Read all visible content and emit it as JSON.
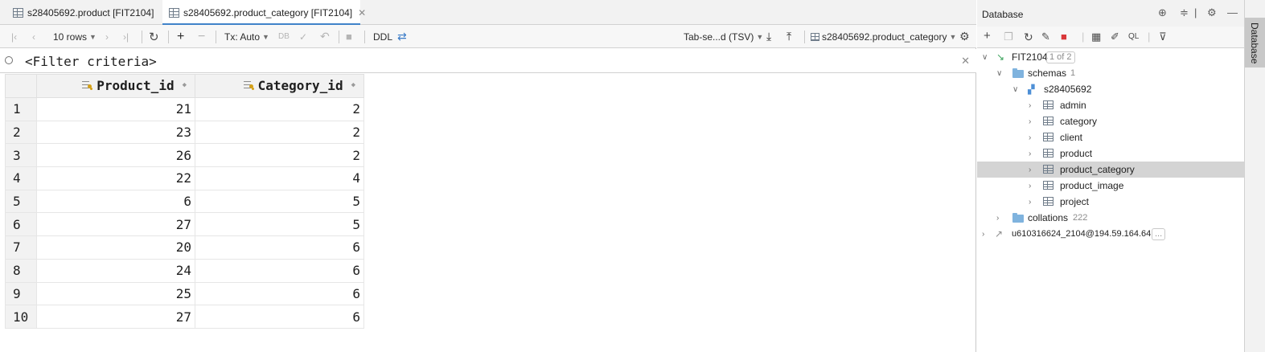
{
  "tabs": [
    {
      "label": "s28405692.product [FIT2104]",
      "active": false
    },
    {
      "label": "s28405692.product_category [FIT2104]",
      "active": true
    }
  ],
  "toolbar": {
    "rows_label": "10 rows",
    "tx_label": "Tx: Auto",
    "ddl_label": "DDL",
    "export_format": "Tab-se...d (TSV)",
    "table_selector": "s28405692.product_category"
  },
  "filter": {
    "placeholder": "<Filter criteria>"
  },
  "grid": {
    "columns": [
      "Product_id",
      "Category_id"
    ],
    "rows": [
      {
        "n": "1",
        "product_id": "21",
        "category_id": "2"
      },
      {
        "n": "2",
        "product_id": "23",
        "category_id": "2"
      },
      {
        "n": "3",
        "product_id": "26",
        "category_id": "2"
      },
      {
        "n": "4",
        "product_id": "22",
        "category_id": "4"
      },
      {
        "n": "5",
        "product_id": "6",
        "category_id": "5"
      },
      {
        "n": "6",
        "product_id": "27",
        "category_id": "5"
      },
      {
        "n": "7",
        "product_id": "20",
        "category_id": "6"
      },
      {
        "n": "8",
        "product_id": "24",
        "category_id": "6"
      },
      {
        "n": "9",
        "product_id": "25",
        "category_id": "6"
      },
      {
        "n": "10",
        "product_id": "27",
        "category_id": "6"
      }
    ]
  },
  "database": {
    "title": "Database",
    "stripe_label": "Database",
    "root": {
      "label": "FIT2104",
      "badge": "1 of 2"
    },
    "schemas": {
      "label": "schemas",
      "count": "1"
    },
    "schema": {
      "label": "s28405692"
    },
    "tables": [
      "admin",
      "category",
      "client",
      "product",
      "product_category",
      "product_image",
      "project"
    ],
    "collations": {
      "label": "collations",
      "count": "222"
    },
    "other_connection": {
      "label": "u610316624_2104@194.59.164.64",
      "badge": "..."
    }
  },
  "colors": {
    "accent": "#4083c9",
    "selected_row": "#d4d4d4",
    "folder": "#7fb3de"
  }
}
